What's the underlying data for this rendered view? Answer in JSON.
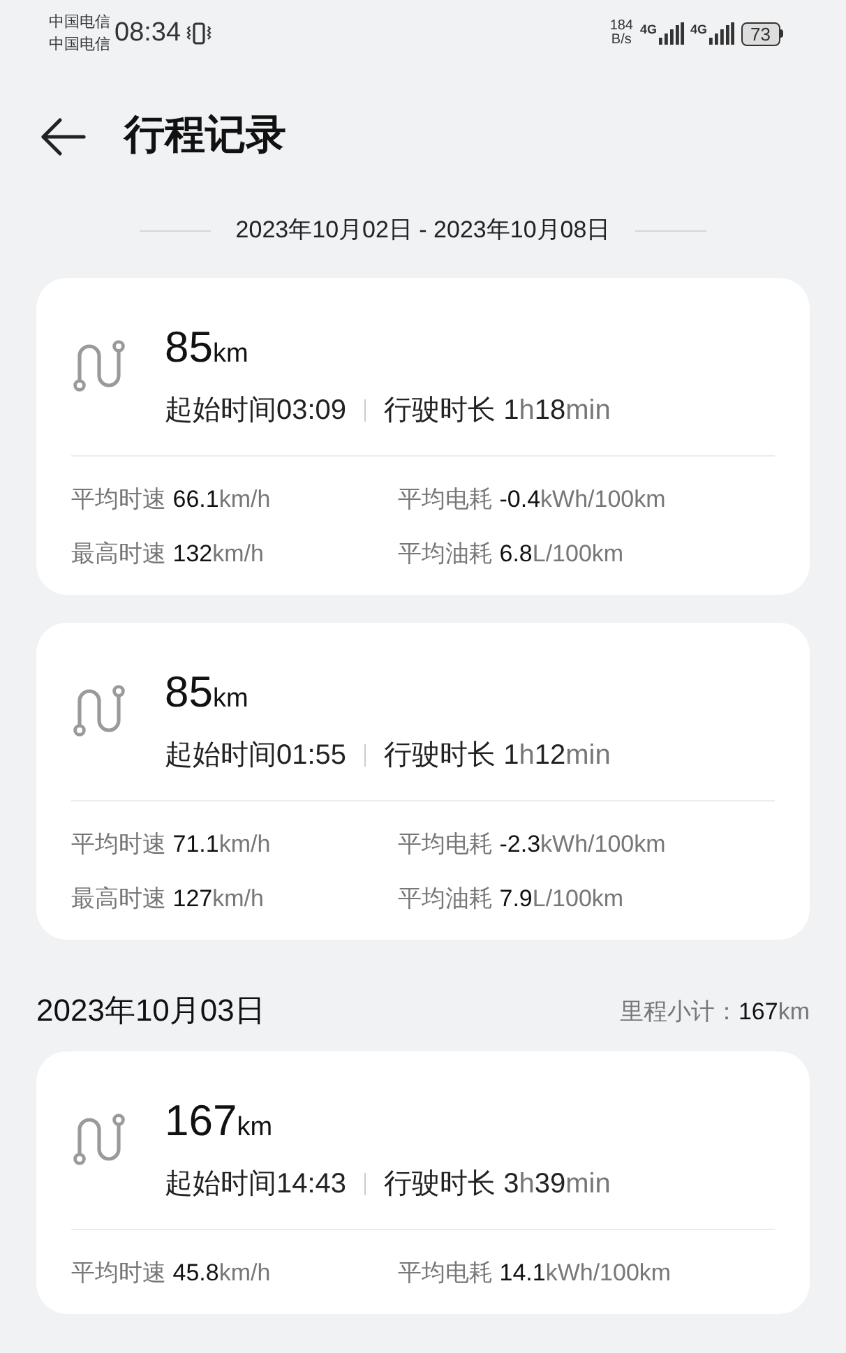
{
  "status_bar": {
    "carriers": [
      "中国电信",
      "中国电信"
    ],
    "time": "08:34",
    "net_speed": "184",
    "net_speed_unit": "B/s",
    "networks": [
      "4G",
      "4G"
    ],
    "battery": "73"
  },
  "header": {
    "title": "行程记录"
  },
  "date_range": "2023年10月02日 - 2023年10月08日",
  "sections": [
    {
      "trips": [
        {
          "distance": "85",
          "distance_unit": "km",
          "start_label": "起始时间",
          "start_time": "03:09",
          "duration_label": "行驶时长",
          "duration": [
            {
              "kind": "number",
              "text": "1"
            },
            {
              "kind": "unit",
              "text": "h"
            },
            {
              "kind": "number",
              "text": "18"
            },
            {
              "kind": "unit",
              "text": "min"
            }
          ],
          "stats": [
            {
              "label": "平均时速",
              "value": "66.1",
              "unit": "km/h"
            },
            {
              "label": "平均电耗",
              "value": "-0.4",
              "unit": "kWh/100km"
            },
            {
              "label": "最高时速",
              "value": "132",
              "unit": "km/h"
            },
            {
              "label": "平均油耗",
              "value": "6.8",
              "unit": "L/100km"
            }
          ]
        },
        {
          "distance": "85",
          "distance_unit": "km",
          "start_label": "起始时间",
          "start_time": "01:55",
          "duration_label": "行驶时长",
          "duration": [
            {
              "kind": "number",
              "text": "1"
            },
            {
              "kind": "unit",
              "text": "h"
            },
            {
              "kind": "number",
              "text": "12"
            },
            {
              "kind": "unit",
              "text": "min"
            }
          ],
          "stats": [
            {
              "label": "平均时速",
              "value": "71.1",
              "unit": "km/h"
            },
            {
              "label": "平均电耗",
              "value": "-2.3",
              "unit": "kWh/100km"
            },
            {
              "label": "最高时速",
              "value": "127",
              "unit": "km/h"
            },
            {
              "label": "平均油耗",
              "value": "7.9",
              "unit": "L/100km"
            }
          ]
        }
      ]
    },
    {
      "date": "2023年10月03日",
      "subtotal_label": "里程小计：",
      "subtotal_value": "167",
      "subtotal_unit": "km",
      "trips": [
        {
          "distance": "167",
          "distance_unit": "km",
          "start_label": "起始时间",
          "start_time": "14:43",
          "duration_label": "行驶时长",
          "duration": [
            {
              "kind": "number",
              "text": "3"
            },
            {
              "kind": "unit",
              "text": "h"
            },
            {
              "kind": "number",
              "text": "39"
            },
            {
              "kind": "unit",
              "text": "min"
            }
          ],
          "stats": [
            {
              "label": "平均时速",
              "value": "45.8",
              "unit": "km/h"
            },
            {
              "label": "平均电耗",
              "value": "14.1",
              "unit": "kWh/100km"
            }
          ]
        }
      ]
    }
  ]
}
